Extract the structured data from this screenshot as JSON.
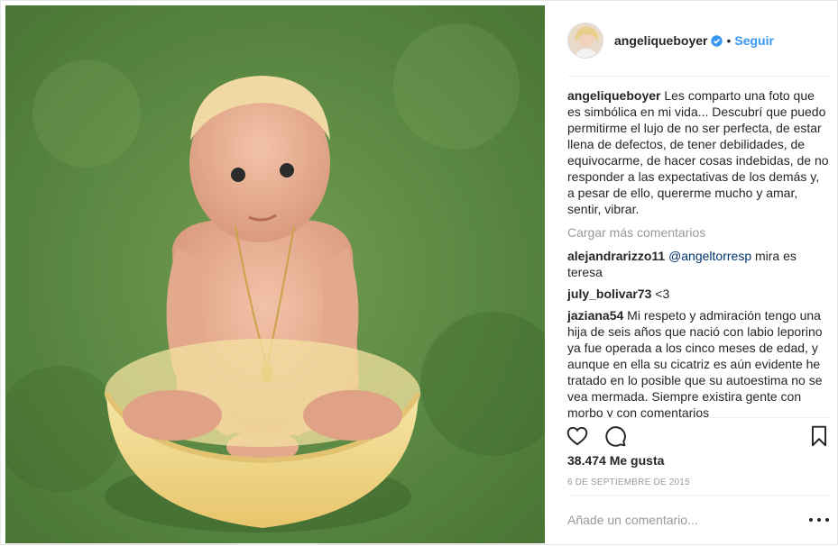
{
  "post": {
    "image_alt": "baby sitting in yellow basin on grass",
    "author": {
      "username": "angeliqueboyer",
      "verified": true,
      "separator": "•",
      "follow_label": "Seguir"
    },
    "caption": {
      "username": "angeliqueboyer",
      "text": "Les comparto una foto que es simbólica en mi vida... Descubrí que puedo permitirme el lujo de no ser perfecta, de estar llena de defectos, de tener debilidades, de equivocarme, de hacer cosas indebidas, de no responder a las expectativas de los demás y, a pesar de ello, quererme mucho y amar, sentir, vibrar."
    },
    "load_more_label": "Cargar más comentarios",
    "comments": [
      {
        "username": "alejandrarizzo11",
        "mention": "@angeltorresp",
        "text": " mira es teresa"
      },
      {
        "username": "july_bolivar73",
        "mention": "",
        "text": "<3"
      },
      {
        "username": "jaziana54",
        "mention": "",
        "text": "Mi respeto y admiración tengo una hija de seis años que nació con labio leporino ya fue operada a los cinco meses de edad, y aunque en ella su cicatriz es aún evidente he tratado en lo posible que su autoestima no se vea mermada. Siempre existira gente con morbo y con comentarios"
      }
    ],
    "likes_label": "38.474 Me gusta",
    "date_label": "6 DE SEPTIEMBRE DE 2015",
    "add_comment_placeholder": "Añade un comentario...",
    "colors": {
      "link": "#3897f0",
      "muted": "#999999",
      "text": "#262626"
    },
    "icons": [
      "heart-icon",
      "comment-icon",
      "bookmark-icon",
      "more-options-icon",
      "verified-badge-icon"
    ]
  }
}
